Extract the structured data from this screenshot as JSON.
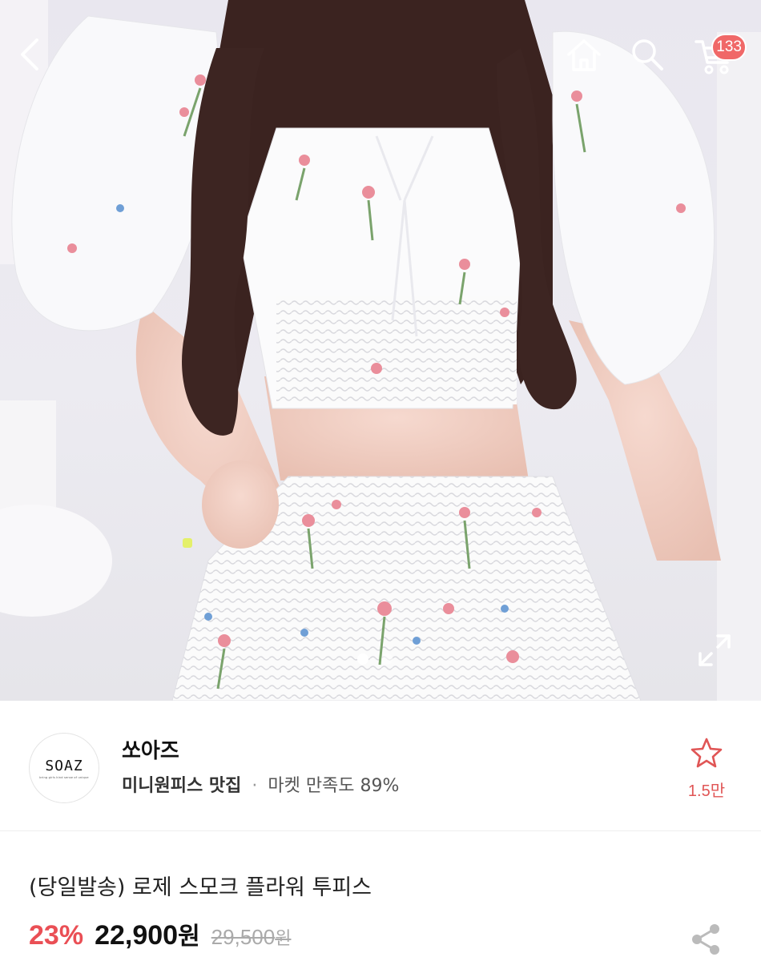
{
  "header": {
    "cart_count": "133"
  },
  "gallery": {
    "page_count": 2,
    "current_page": 1
  },
  "seller": {
    "logo_text": "SOAZ",
    "logo_tagline": "bring girls kind sense of unique",
    "name": "쏘아즈",
    "category": "미니원피스 맛집",
    "separator": "·",
    "satisfaction": "마켓 만족도 89%",
    "favorite_count": "1.5만"
  },
  "product": {
    "title": "(당일발송) 로제 스모크 플라워 투피스",
    "discount": "23%",
    "price": "22,900",
    "price_unit": "원",
    "original_price": "29,500",
    "original_unit": "원"
  },
  "colors": {
    "accent_red": "#ea4f55",
    "badge_red": "#f06868"
  },
  "icons": [
    "back-icon",
    "home-icon",
    "search-icon",
    "cart-icon",
    "expand-icon",
    "star-icon",
    "share-icon"
  ]
}
